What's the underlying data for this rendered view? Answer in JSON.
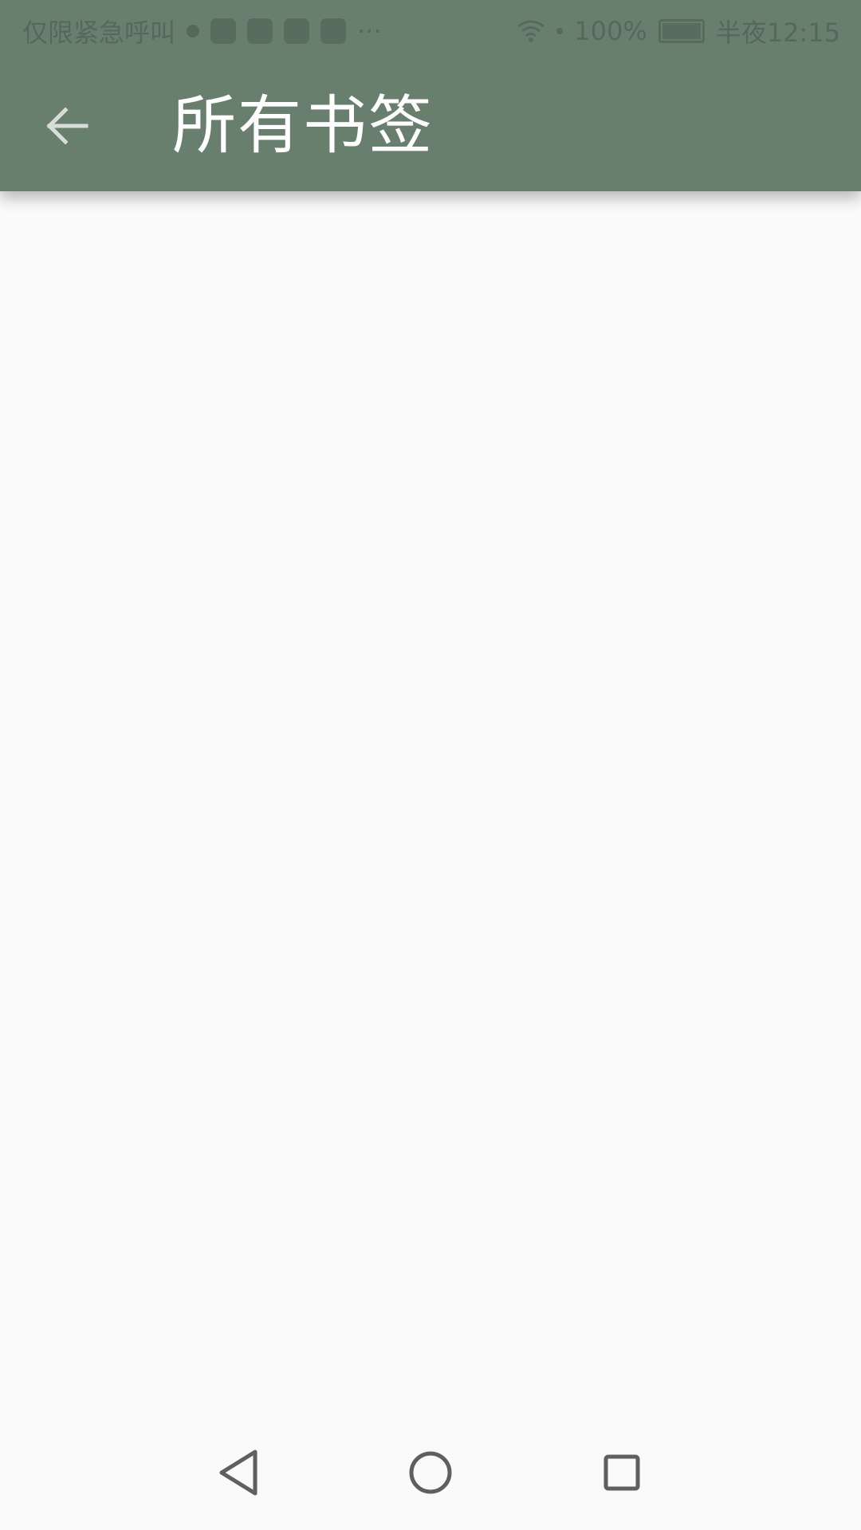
{
  "status_bar": {
    "left_text": "仅限紧急呼叫",
    "battery": "100%",
    "time": "半夜12:15"
  },
  "header": {
    "title": "所有书签",
    "back_icon": "arrow-back-icon"
  },
  "nav_bar": {
    "back_icon": "nav-back-icon",
    "home_icon": "nav-home-icon",
    "recents_icon": "nav-recents-icon"
  },
  "colors": {
    "app_bar": "#687f6e",
    "background": "#fafafa",
    "title": "#ffffff",
    "nav_icon": "#5f5f5f"
  }
}
